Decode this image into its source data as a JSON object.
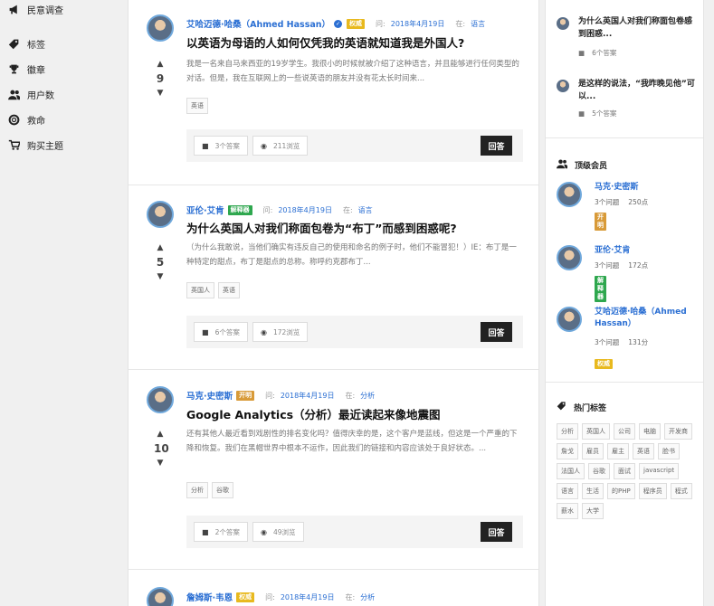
{
  "nav": [
    {
      "label": "民意调查",
      "icon": "megaphone-icon"
    },
    {
      "label": "标签",
      "icon": "tag-icon"
    },
    {
      "label": "徽章",
      "icon": "trophy-icon"
    },
    {
      "label": "用户数",
      "icon": "users-icon"
    },
    {
      "label": "救命",
      "icon": "lifebuoy-icon"
    },
    {
      "label": "购买主题",
      "icon": "cart-icon"
    }
  ],
  "questions": [
    {
      "author": "艾哈迈德·哈桑（Ahmed Hassan）",
      "verified": true,
      "badge": "权威",
      "asked_label": "问:",
      "date": "2018年4月19日",
      "in_label": "在:",
      "category": "语言",
      "title": "以英语为母语的人如何仅凭我的英语就知道我是外国人?",
      "excerpt": "我是一名来自马来西亚的19岁学生。我很小的时候就被介绍了这种语言，并且能够进行任何类型的对话。但是，我在互联网上的一些说英语的朋友并没有花太长时间来...",
      "votes": "9",
      "tags": [
        "英语"
      ],
      "answers": "3个答案",
      "views": "211浏览",
      "answer_btn": "回答"
    },
    {
      "author": "亚伦·艾肯",
      "verified": false,
      "badge": "解释器",
      "asked_label": "问:",
      "date": "2018年4月19日",
      "in_label": "在:",
      "category": "语言",
      "title": "为什么英国人对我们称面包卷为“布丁”而感到困惑呢?",
      "excerpt": "（为什么我敢说，当他们确实有违反自己的使用和命名的例子时，他们不能冒犯！）IE：布丁是一种特定的甜点，布丁是甜点的总称。称呼约克郡布丁...",
      "votes": "5",
      "tags": [
        "英国人",
        "英语"
      ],
      "answers": "6个答案",
      "views": "172浏览",
      "answer_btn": "回答"
    },
    {
      "author": "马克·史密斯",
      "verified": false,
      "badge": "开明",
      "asked_label": "问:",
      "date": "2018年4月19日",
      "in_label": "在:",
      "category": "分析",
      "title": "Google Analytics（分析）最近读起来像地震图",
      "excerpt": "还有其他人最近看到戏剧性的排名变化吗？值得庆幸的是，这个客户是蓝线，但这是一个严重的下降和恢复。我们在黑帽世界中根本不运作，因此我们的链接和内容应该处于良好状态。...",
      "votes": "10",
      "tags": [
        "分析",
        "谷歌"
      ],
      "answers": "2个答案",
      "views": "49浏览",
      "answer_btn": "回答"
    },
    {
      "author": "詹姆斯·韦恩",
      "verified": false,
      "badge": "权威",
      "asked_label": "问:",
      "date": "2018年4月19日",
      "in_label": "在:",
      "category": "分析"
    }
  ],
  "related": [
    {
      "title": "为什么英国人对我们称面包卷感到困惑...",
      "answers": "6个答案"
    },
    {
      "title": "是这样的说法，“我昨晚见他”可以...",
      "answers": "5个答案"
    }
  ],
  "top_members": {
    "title": "顶级会员",
    "members": [
      {
        "name": "马克·史密斯",
        "questions": "3个问题",
        "points": "250点",
        "badge": "开明"
      },
      {
        "name": "亚伦·艾肯",
        "questions": "3个问题",
        "points": "172点",
        "badge": "解释器"
      },
      {
        "name": "艾哈迈德·哈桑（Ahmed Hassan）",
        "questions": "3个问题",
        "points": "131分",
        "badge": "权威"
      }
    ]
  },
  "hot_tags": {
    "title": "热门标签",
    "tags": [
      "分析",
      "英国人",
      "公司",
      "电脑",
      "开发商",
      "詹戈",
      "雇员",
      "雇主",
      "英语",
      "脸书",
      "法国人",
      "谷歌",
      "面试",
      "javascript",
      "语言",
      "生活",
      "的PHP",
      "程序员",
      "程式",
      "薪水",
      "大学"
    ]
  },
  "colors": {
    "accent": "#2b6fd3",
    "gold": "#e8b91e",
    "orange": "#d89a38",
    "green": "#2ea74e",
    "dark": "#222222"
  }
}
